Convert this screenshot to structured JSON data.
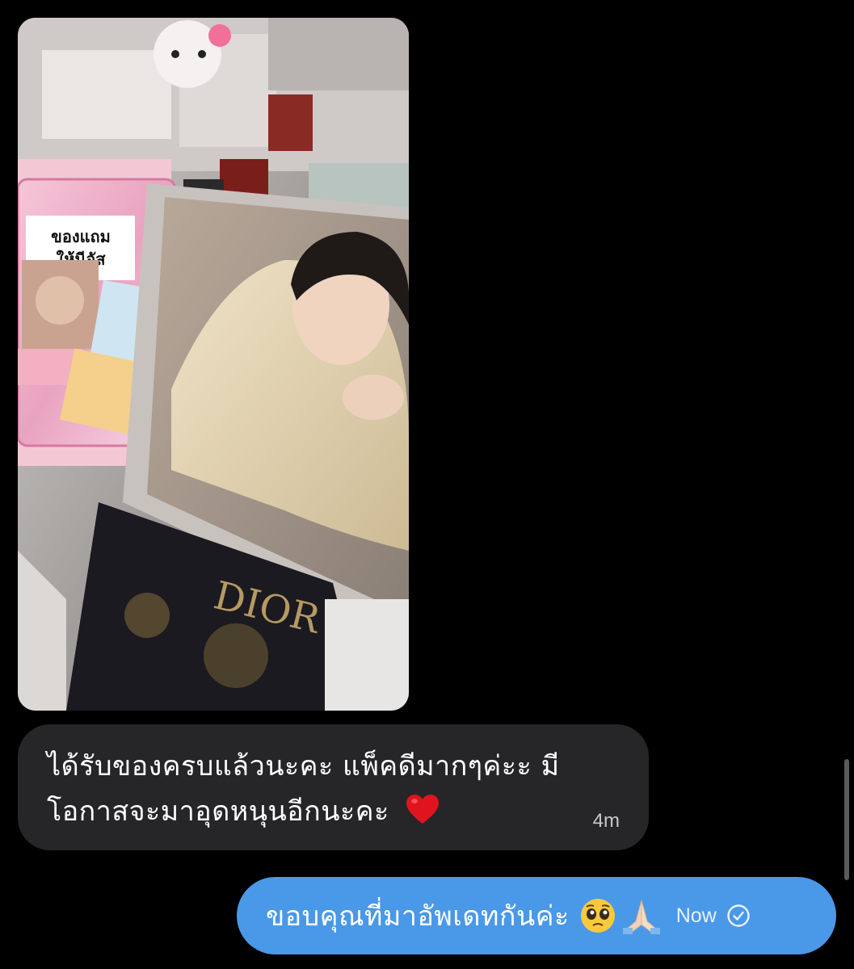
{
  "conversation": {
    "incoming_message": {
      "text": "ได้รับของครบแล้วนะคะ แพ็คดีมากๆค่ะะ มีโอกาสจะมาอุดหนุนอีกนะคะ",
      "emoji": "red-heart",
      "time": "4m"
    },
    "photo_message": {
      "photo_label_text": "ของแถม ให้นีอัส",
      "photo_brand_text": "DIOR"
    },
    "outgoing_message": {
      "text": "ขอบคุณที่มาอัพเดทกันค่ะ",
      "emojis": [
        "pleading-face",
        "folded-hands"
      ],
      "time": "Now",
      "status_icon": "sent-check-icon"
    }
  },
  "colors": {
    "background": "#000000",
    "incoming_bubble": "#262628",
    "outgoing_bubble": "#4a98e8",
    "heart": "#e0141e"
  }
}
